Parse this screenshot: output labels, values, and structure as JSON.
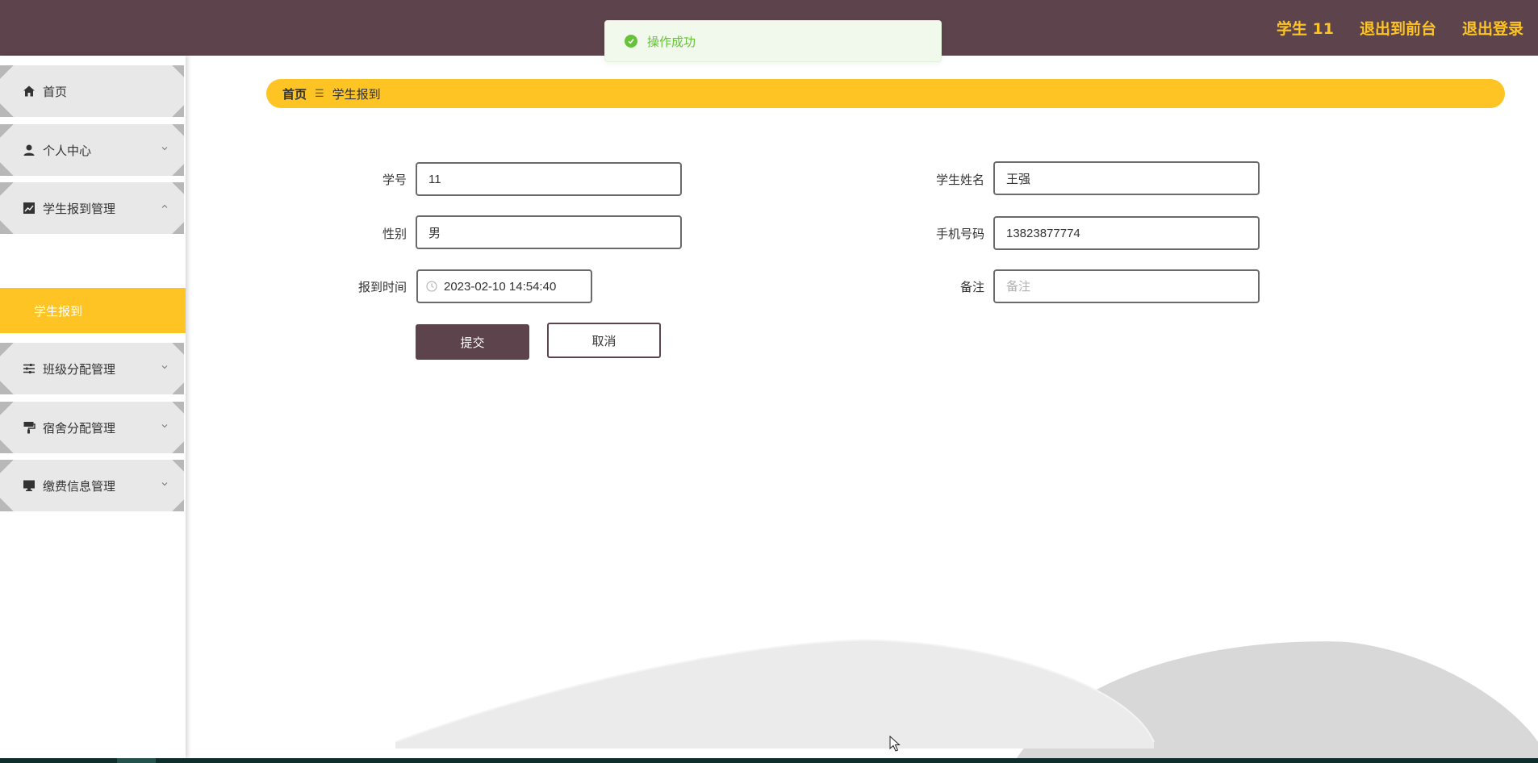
{
  "header": {
    "user_name": "学生 11",
    "front_link": "退出到前台",
    "logout_link": "退出登录",
    "bg_color": "#5c434c",
    "accent_color": "#fdc424"
  },
  "toast": {
    "message": "操作成功",
    "icon": "check-circle-icon",
    "color": "#67c23a"
  },
  "sidebar": {
    "items": [
      {
        "label": "首页",
        "icon": "home-icon"
      },
      {
        "label": "个人中心",
        "icon": "user-icon"
      },
      {
        "label": "学生报到管理",
        "icon": "chart-icon",
        "expanded": true
      },
      {
        "label": "班级分配管理",
        "icon": "sliders-icon"
      },
      {
        "label": "宿舍分配管理",
        "icon": "paint-roller-icon"
      },
      {
        "label": "缴费信息管理",
        "icon": "monitor-icon"
      }
    ],
    "active_subitem": "学生报到"
  },
  "breadcrumb": {
    "home": "首页",
    "separator": "☰",
    "current": "学生报到"
  },
  "form": {
    "student_no": {
      "label": "学号",
      "value": "11"
    },
    "student_name": {
      "label": "学生姓名",
      "value": "王强"
    },
    "gender": {
      "label": "性别",
      "value": "男"
    },
    "phone": {
      "label": "手机号码",
      "value": "13823877774"
    },
    "report_time": {
      "label": "报到时间",
      "value": "2023-02-10 14:54:40"
    },
    "remark": {
      "label": "备注",
      "value": "",
      "placeholder": "备注"
    },
    "submit_label": "提交",
    "cancel_label": "取消"
  }
}
